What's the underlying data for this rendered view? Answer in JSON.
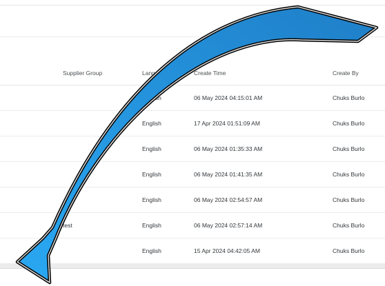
{
  "table": {
    "headers": {
      "supplier_group": "Supplier Group",
      "language": "Language",
      "create_time": "Create Time",
      "create_by": "Create By"
    },
    "rows": [
      {
        "supplier_group": "",
        "language": "English",
        "create_time": "06 May 2024 04:15:01 AM",
        "create_by": "Chuks Burlo"
      },
      {
        "supplier_group": "",
        "language": "English",
        "create_time": "17 Apr 2024 01:51:09 AM",
        "create_by": "Chuks Burlo"
      },
      {
        "supplier_group": "",
        "language": "English",
        "create_time": "06 May 2024 01:35:33 AM",
        "create_by": "Chuks Burlo"
      },
      {
        "supplier_group": "",
        "language": "English",
        "create_time": "06 May 2024 01:41:35 AM",
        "create_by": "Chuks Burlo"
      },
      {
        "supplier_group": "",
        "language": "English",
        "create_time": "06 May 2024 02:54:57 AM",
        "create_by": "Chuks Burlo"
      },
      {
        "supplier_group": "test",
        "language": "English",
        "create_time": "06 May 2024 02:57:14 AM",
        "create_by": "Chuks Burlo"
      },
      {
        "supplier_group": "",
        "language": "English",
        "create_time": "15 Apr 2024 04:42:05 AM",
        "create_by": "Chuks Burlo"
      }
    ]
  },
  "overlay": {
    "arrow_icon": "curved-arrow-icon",
    "arrow_fill": "#2b8fd6",
    "arrow_outline": "#000000"
  }
}
